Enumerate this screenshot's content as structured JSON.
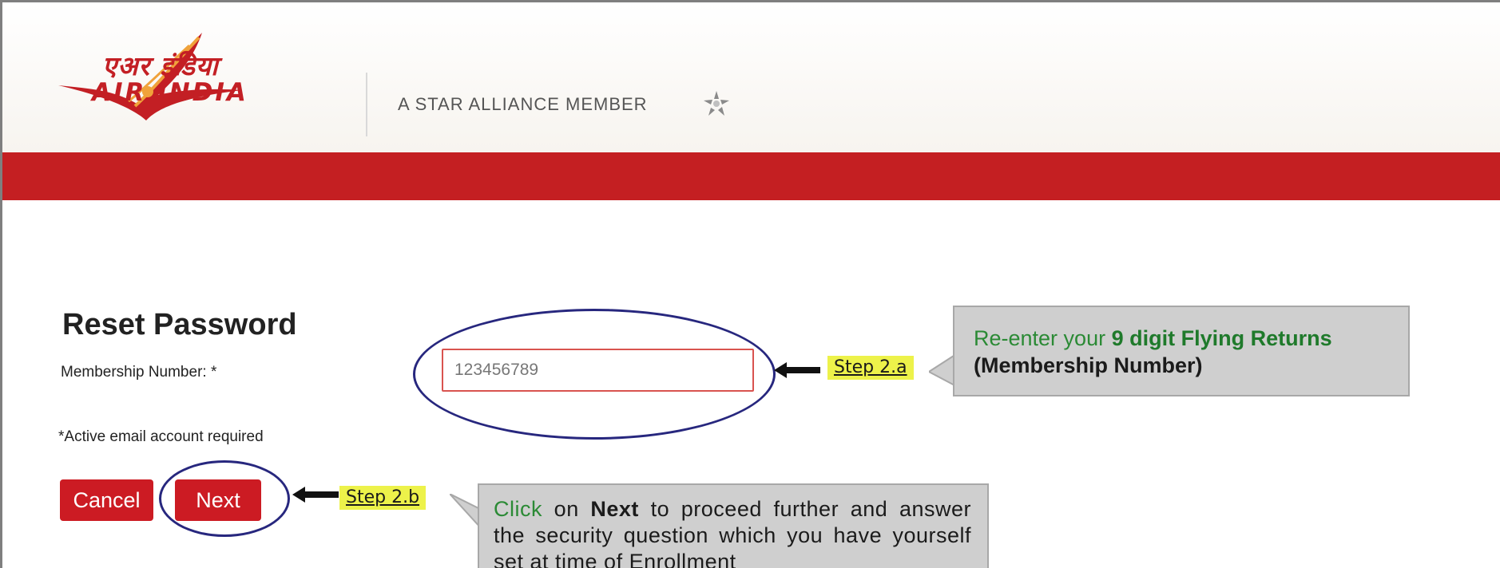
{
  "header": {
    "logo_hindi": "एअर इंडिया",
    "logo_english": "AIR INDIA",
    "alliance_text": "A STAR ALLIANCE MEMBER",
    "alliance_icon": "star-alliance-icon"
  },
  "form": {
    "title": "Reset Password",
    "membership_label": "Membership Number:  *",
    "membership_value": "123456789",
    "email_note": "*Active email account required",
    "cancel_label": "Cancel",
    "next_label": "Next"
  },
  "annotations": {
    "step_a": "Step 2.a",
    "step_b": "Step 2.b",
    "callout_a": {
      "prefix": "Re-enter your ",
      "bold": "9 digit Flying Returns",
      "line2": "(Membership Number)"
    },
    "callout_b": {
      "click": "Click",
      "on": " on ",
      "next": "Next",
      "rest": " to proceed further and answer the security question which you have yourself set at time of Enrollment"
    }
  },
  "colors": {
    "brand_red": "#c41f22",
    "button_red": "#cc1b23",
    "annotation_ring": "#27277e",
    "step_highlight": "#edf24a",
    "callout_bg": "#cfcfcf",
    "callout_green": "#2b8a35"
  }
}
